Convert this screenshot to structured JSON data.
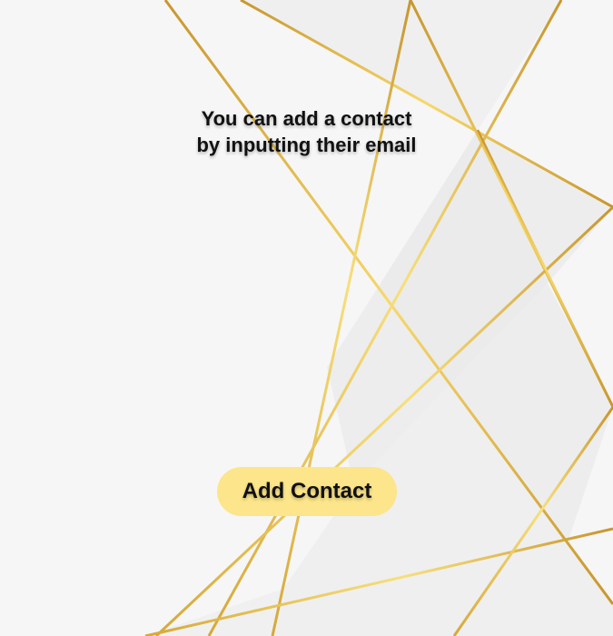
{
  "prompt": {
    "line1": "You can add a contact",
    "line2": "by inputting their email"
  },
  "actions": {
    "add_contact_label": "Add Contact"
  },
  "theme": {
    "background": "#f5f5f5",
    "accent": "#fce58a",
    "line_gold": "#d4a73a",
    "line_light_gold": "#f3d46a",
    "text": "#111111"
  }
}
